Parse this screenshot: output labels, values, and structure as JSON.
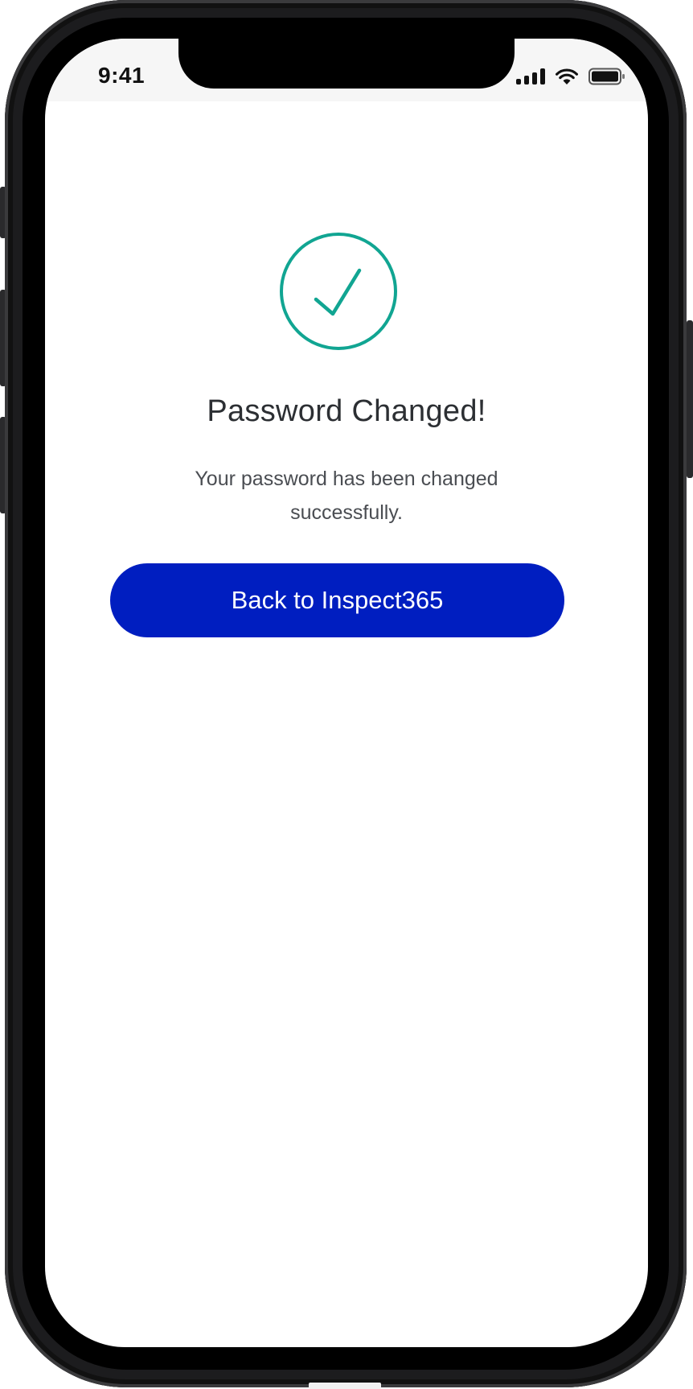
{
  "status_bar": {
    "time": "9:41",
    "icons": [
      "signal-icon",
      "wifi-icon",
      "battery-icon"
    ]
  },
  "content": {
    "success_icon": "check-circle-icon",
    "title": "Password Changed!",
    "message": "Your password has been changed successfully.",
    "back_button_label": "Back to Inspect365"
  },
  "colors": {
    "accent": "#11a592",
    "button_background": "#001ec0",
    "button_text": "#ffffff",
    "title_text": "#2c2f33",
    "body_text": "#4a4d52"
  }
}
